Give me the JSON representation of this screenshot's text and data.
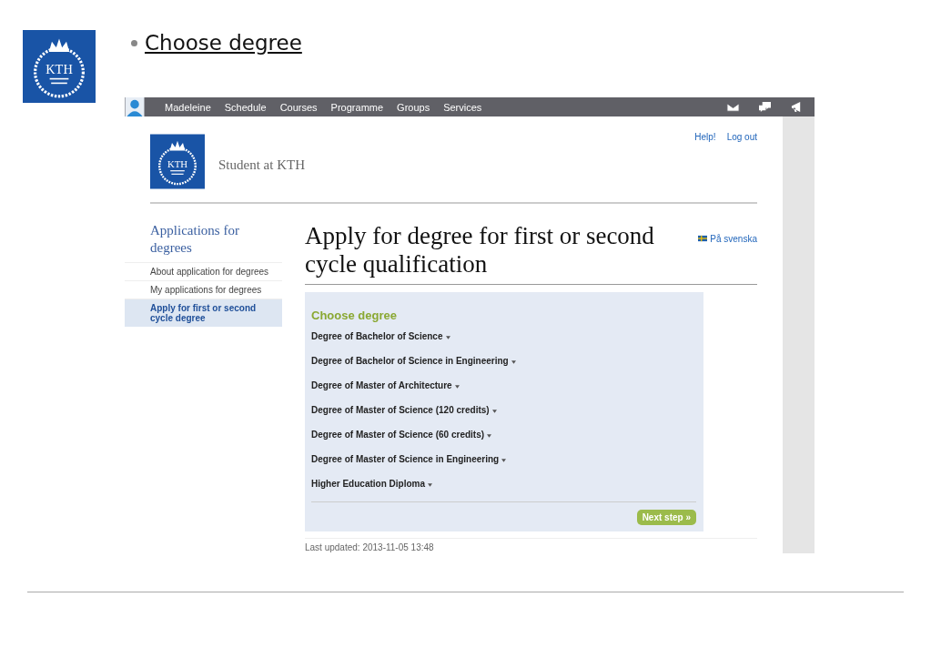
{
  "slide": {
    "logo": {
      "name": "KTH"
    },
    "bullet_title": "Choose degree"
  },
  "nav": {
    "items": [
      "Madeleine",
      "Schedule",
      "Courses",
      "Programme",
      "Groups",
      "Services"
    ]
  },
  "header": {
    "logo": {
      "name": "KTH"
    },
    "site_title": "Student at KTH",
    "links": [
      "Help!",
      "Log out"
    ]
  },
  "sidebar": {
    "title": "Applications for degrees",
    "items": [
      {
        "label": "About application for degrees",
        "selected": false
      },
      {
        "label": "My applications for degrees",
        "selected": false
      },
      {
        "label": "Apply for first or second cycle degree",
        "selected": true
      }
    ]
  },
  "main": {
    "heading": "Apply for degree for first or second cycle qualification",
    "language_link": "På svenska",
    "panel": {
      "title": "Choose degree",
      "options": [
        "Degree of Bachelor of Science",
        "Degree of Bachelor of Science in Engineering",
        "Degree of Master of Architecture",
        "Degree of Master of Science (120 credits)",
        "Degree of Master of Science (60 credits)",
        "Degree of Master of Science in Engineering",
        "Higher Education Diploma"
      ],
      "next_button": "Next step »"
    },
    "last_updated": "Last updated: 2013-11-05 13:48"
  }
}
